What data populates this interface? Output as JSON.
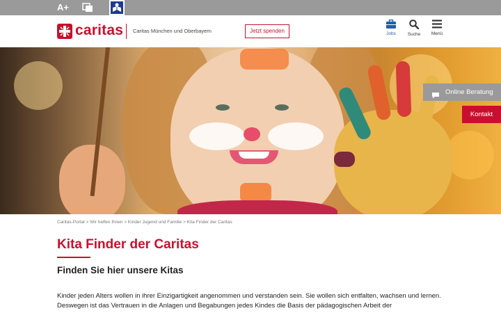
{
  "topbar": {
    "font_size_label": "A+",
    "icons": [
      "font-size-icon",
      "contrast-icon",
      "easy-language-icon"
    ]
  },
  "header": {
    "logo_text": "caritas",
    "logo_subtitle": "Caritas München und Oberbayern",
    "donate_label": "Jetzt spenden",
    "nav": [
      {
        "label": "Jobs",
        "icon": "briefcase-icon"
      },
      {
        "label": "Suche",
        "icon": "search-icon"
      },
      {
        "label": "Menü",
        "icon": "menu-icon"
      }
    ]
  },
  "floating": {
    "online_label": "Online Beratung",
    "kontakt_label": "Kontakt"
  },
  "breadcrumb": {
    "items": [
      "Caritas-Portal",
      "Wir helfen Ihnen",
      "Kinder Jugend und Familie",
      "Kita Finder der Caritas"
    ],
    "separator": ">"
  },
  "main": {
    "title": "Kita Finder der Caritas",
    "subtitle": "Finden Sie hier unsere Kitas",
    "intro_line1": "Kinder jeden Alters wollen in ihrer Einzigartigkeit angenommen und verstanden sein. Sie wollen sich entfalten, wachsen und lernen.",
    "intro_line2": "Deswegen ist das Vertrauen in die Anlagen und Begabungen jedes Kindes die Basis der pädagogischen Arbeit der"
  },
  "colors": {
    "brand_red": "#c8102e",
    "topbar_grey": "#9a9a9a",
    "jobs_blue": "#1f5fa8",
    "easy_language_blue": "#1f3a93"
  }
}
